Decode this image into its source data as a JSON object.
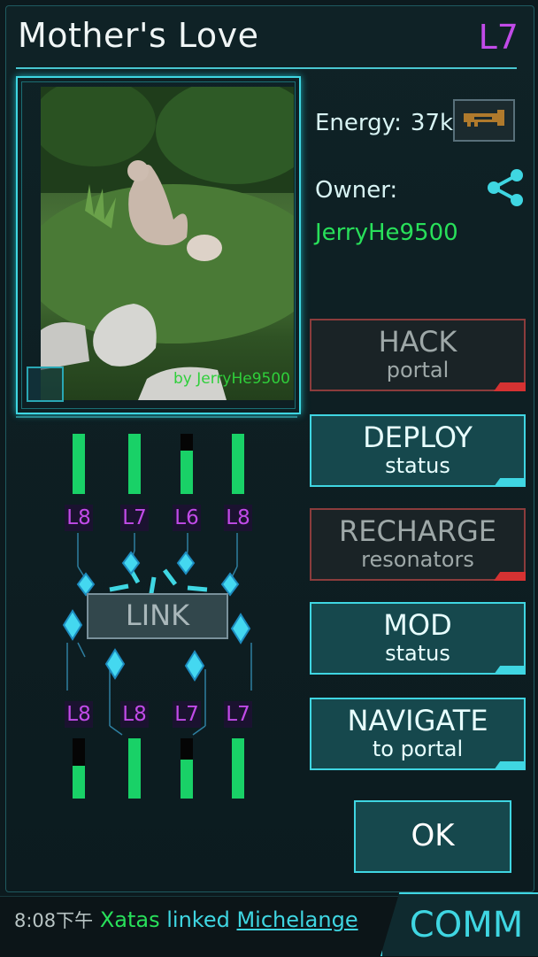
{
  "portal": {
    "title": "Mother's Love",
    "level": "L7",
    "photo_credit": "by JerryHe9500",
    "energy_label": "Energy:",
    "energy_value": "37k",
    "owner_label": "Owner:",
    "owner_name": "JerryHe9500"
  },
  "actions": {
    "hack": {
      "l1": "HACK",
      "l2": "portal"
    },
    "deploy": {
      "l1": "DEPLOY",
      "l2": "status"
    },
    "recharge": {
      "l1": "RECHARGE",
      "l2": "resonators"
    },
    "mod": {
      "l1": "MOD",
      "l2": "status"
    },
    "navigate": {
      "l1": "NAVIGATE",
      "l2": "to portal"
    },
    "ok": "OK"
  },
  "link_label": "LINK",
  "resonators": {
    "top": [
      {
        "level": "L8",
        "charge": 1.0
      },
      {
        "level": "L7",
        "charge": 1.0
      },
      {
        "level": "L6",
        "charge": 0.72
      },
      {
        "level": "L8",
        "charge": 1.0
      }
    ],
    "bottom": [
      {
        "level": "L8",
        "charge": 0.55
      },
      {
        "level": "L8",
        "charge": 1.0
      },
      {
        "level": "L7",
        "charge": 0.65
      },
      {
        "level": "L7",
        "charge": 1.0
      }
    ]
  },
  "comm": {
    "label": "COMM",
    "ticker": {
      "time": "8:08下午",
      "agent": "Xatas",
      "verb": "linked",
      "target": "Michelange"
    }
  },
  "colors": {
    "accent": "#3fd6e2",
    "level_purple": "#c14be8",
    "owner_green": "#28e05a",
    "alert_red": "#d63232"
  }
}
